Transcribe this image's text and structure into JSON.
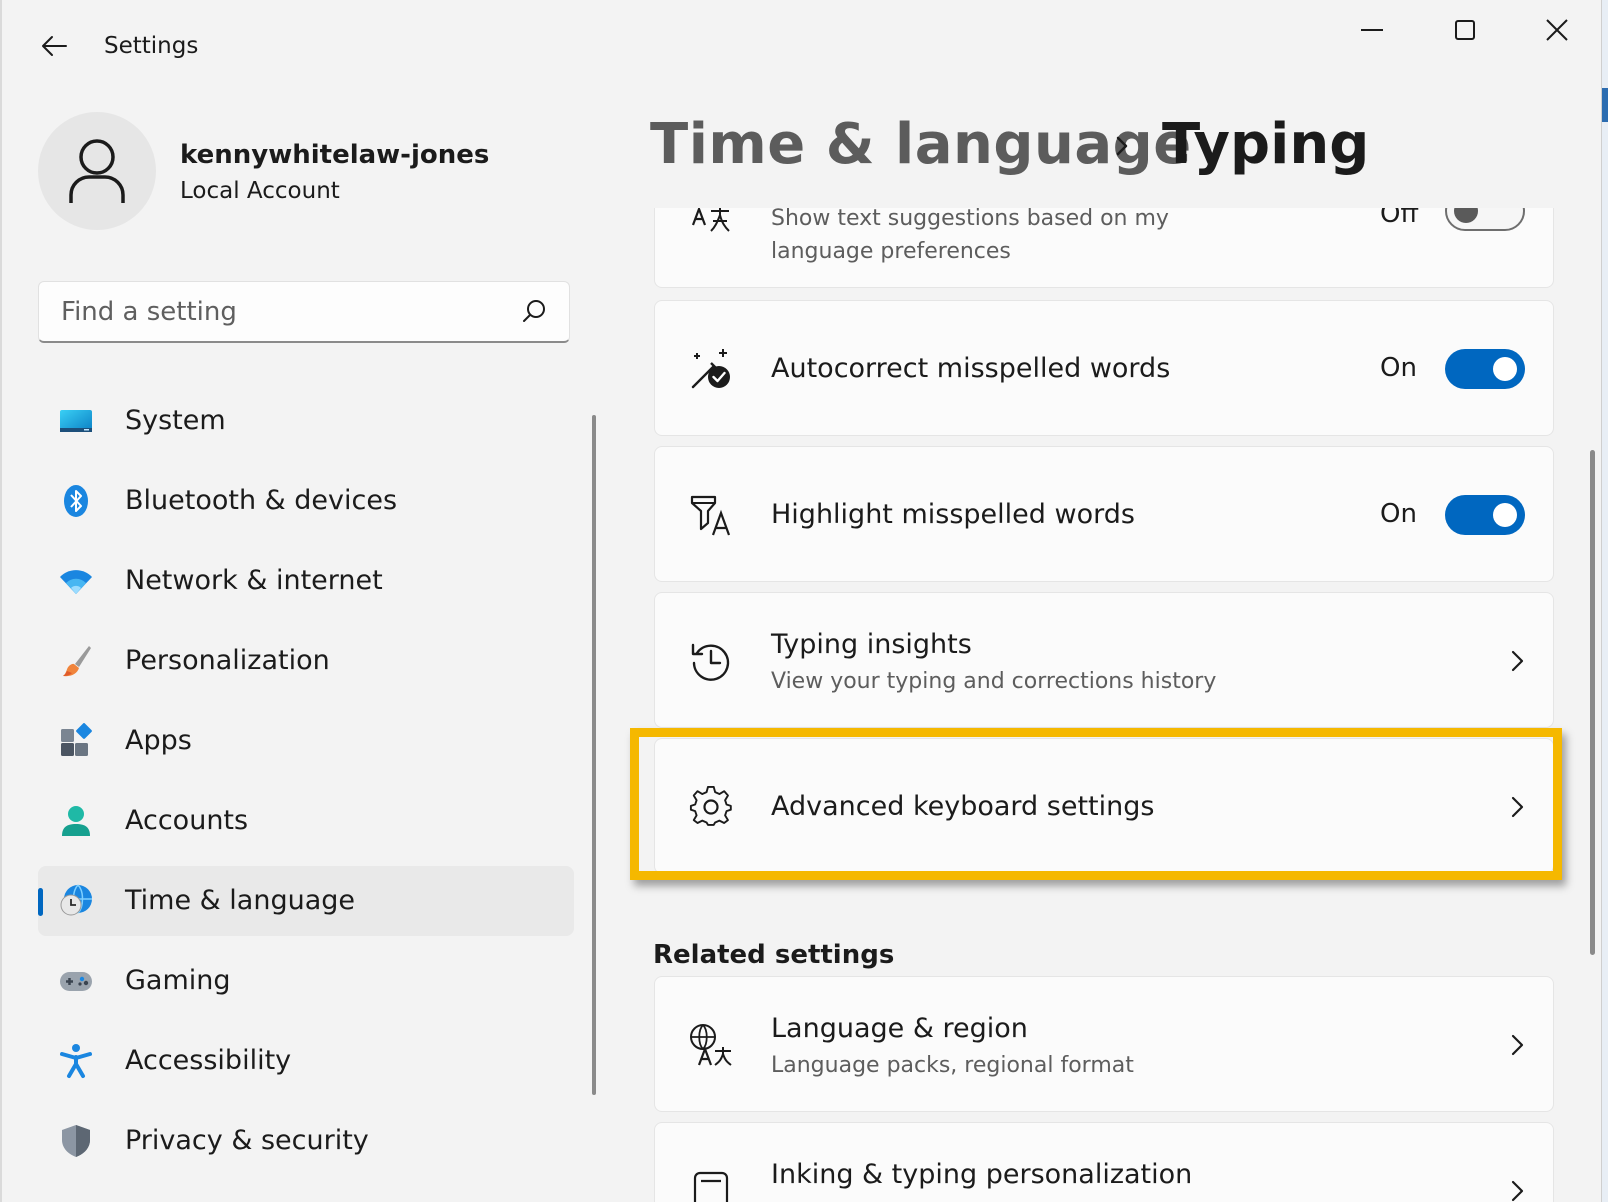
{
  "window": {
    "title": "Settings",
    "controls": {
      "minimize": "minimize-icon",
      "maximize": "maximize-icon",
      "close": "close-icon"
    }
  },
  "profile": {
    "name": "kennywhitelaw-jones",
    "account_type": "Local Account"
  },
  "search": {
    "placeholder": "Find a setting",
    "value": ""
  },
  "nav": {
    "items": [
      {
        "label": "System",
        "icon": "monitor-icon"
      },
      {
        "label": "Bluetooth & devices",
        "icon": "bluetooth-icon"
      },
      {
        "label": "Network & internet",
        "icon": "wifi-icon"
      },
      {
        "label": "Personalization",
        "icon": "paintbrush-icon"
      },
      {
        "label": "Apps",
        "icon": "apps-icon"
      },
      {
        "label": "Accounts",
        "icon": "person-icon"
      },
      {
        "label": "Time & language",
        "icon": "globe-clock-icon",
        "selected": true
      },
      {
        "label": "Gaming",
        "icon": "gamepad-icon"
      },
      {
        "label": "Accessibility",
        "icon": "accessibility-icon"
      },
      {
        "label": "Privacy & security",
        "icon": "shield-icon"
      }
    ]
  },
  "breadcrumb": {
    "parent": "Time & language",
    "current": "Typing"
  },
  "settings": {
    "text_suggestions": {
      "title": "Show text suggestions based on my",
      "subtitle": "language preferences",
      "state": "Off",
      "icon": "text-suggestion-icon"
    },
    "autocorrect": {
      "title": "Autocorrect misspelled words",
      "state": "On",
      "icon": "autocorrect-icon"
    },
    "highlight": {
      "title": "Highlight misspelled words",
      "state": "On",
      "icon": "highlight-icon"
    },
    "typing_insights": {
      "title": "Typing insights",
      "subtitle": "View your typing and corrections history",
      "icon": "history-icon"
    },
    "advanced_keyboard": {
      "title": "Advanced keyboard settings",
      "icon": "gear-icon",
      "highlighted": true
    }
  },
  "related": {
    "heading": "Related settings",
    "items": [
      {
        "title": "Language & region",
        "subtitle": "Language packs, regional format",
        "icon": "language-icon"
      },
      {
        "title": "Inking & typing personalization",
        "icon": "keyboard-icon"
      }
    ]
  },
  "colors": {
    "accent": "#0067c0",
    "highlight_frame": "#f5b800",
    "background": "#f3f3f3"
  }
}
